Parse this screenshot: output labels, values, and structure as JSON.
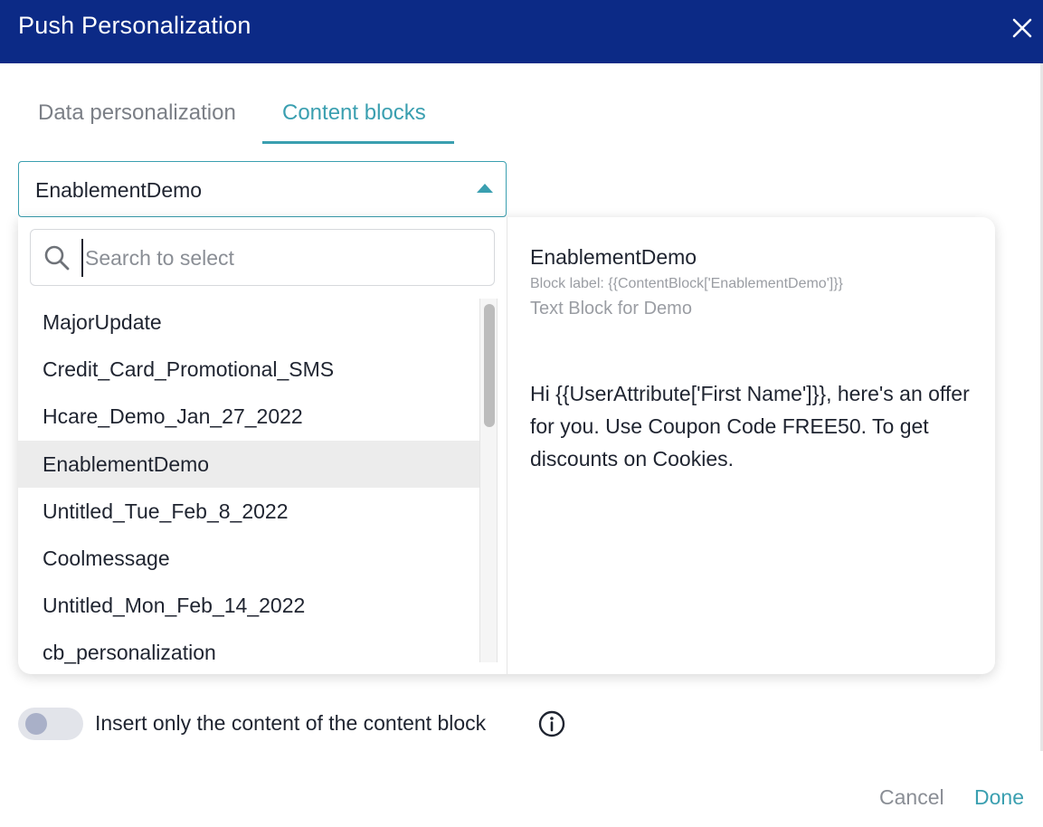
{
  "dialog": {
    "title": "Push Personalization",
    "close_icon": "close-icon"
  },
  "tabs": [
    {
      "label": "Data personalization",
      "active": false
    },
    {
      "label": "Content blocks",
      "active": true
    }
  ],
  "select": {
    "value": "EnablementDemo",
    "icon": "caret-up-icon"
  },
  "search": {
    "placeholder": "Search to select",
    "value": "",
    "icon": "search-icon"
  },
  "list": {
    "items": [
      "MajorUpdate",
      "Credit_Card_Promotional_SMS",
      "Hcare_Demo_Jan_27_2022",
      "EnablementDemo",
      "Untitled_Tue_Feb_8_2022",
      "Coolmessage",
      "Untitled_Mon_Feb_14_2022",
      "cb_personalization"
    ],
    "selected": "EnablementDemo"
  },
  "preview": {
    "title": "EnablementDemo",
    "label": "Block label: {{ContentBlock['EnablementDemo']}}",
    "description": "Text Block for Demo",
    "body": "Hi {{UserAttribute['First Name']}}, here's an offer for you. Use Coupon Code FREE50. To get discounts on Cookies."
  },
  "toggle": {
    "label": "Insert only the content of the content block",
    "on": false,
    "info_icon": "info-icon"
  },
  "footer": {
    "cancel_label": "Cancel",
    "done_label": "Done"
  },
  "colors": {
    "header": "#0c2a86",
    "accent": "#3a9fb0",
    "selected_row": "#ececec"
  }
}
